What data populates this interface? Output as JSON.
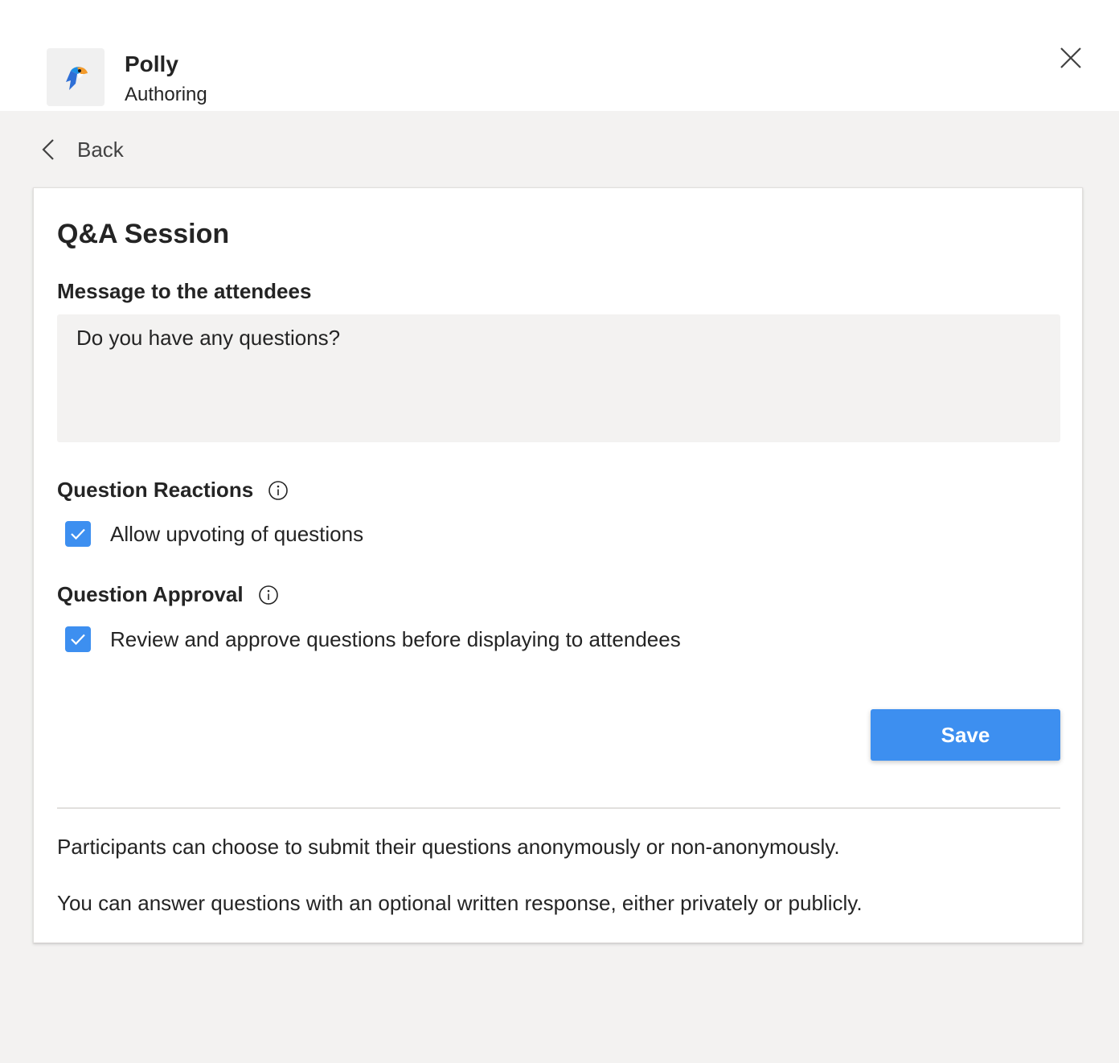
{
  "header": {
    "app_name": "Polly",
    "app_subtitle": "Authoring",
    "icon": "polly-parrot-logo",
    "close_icon": "close-icon"
  },
  "nav": {
    "back_label": "Back",
    "back_icon": "chevron-left-icon"
  },
  "form": {
    "title": "Q&A Session",
    "message_label": "Message to the attendees",
    "message_value": "Do you have any questions?",
    "reactions": {
      "title": "Question Reactions",
      "info_icon": "info-icon",
      "option_label": "Allow upvoting of questions",
      "checked": true
    },
    "approval": {
      "title": "Question Approval",
      "info_icon": "info-icon",
      "option_label": "Review and approve questions before displaying to attendees",
      "checked": true
    },
    "save_label": "Save"
  },
  "notes": [
    "Participants can choose to submit their questions anonymously or non-anonymously.",
    "You can answer questions with an optional written response, either privately or publicly."
  ],
  "colors": {
    "accent": "#3d8ff0",
    "page_bg": "#f3f2f1",
    "text": "#242424"
  }
}
